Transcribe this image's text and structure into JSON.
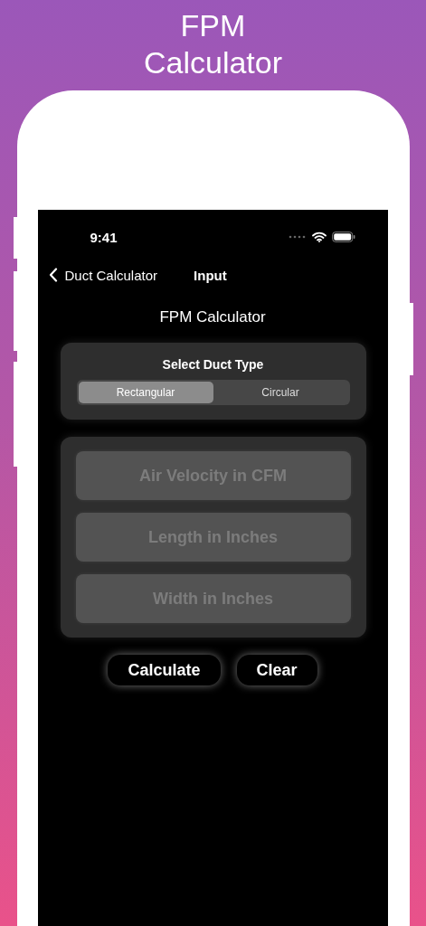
{
  "headline": [
    "FPM",
    "Calculator"
  ],
  "status_bar": {
    "time": "9:41"
  },
  "nav": {
    "back_label": "Duct Calculator",
    "title": "Input"
  },
  "screen_title": "FPM Calculator",
  "duct_type": {
    "label": "Select Duct Type",
    "options": [
      {
        "label": "Rectangular",
        "selected": true
      },
      {
        "label": "Circular",
        "selected": false
      }
    ]
  },
  "fields": [
    {
      "placeholder": "Air Velocity in CFM"
    },
    {
      "placeholder": "Length in Inches"
    },
    {
      "placeholder": "Width in Inches"
    }
  ],
  "buttons": [
    "Calculate",
    "Clear"
  ]
}
